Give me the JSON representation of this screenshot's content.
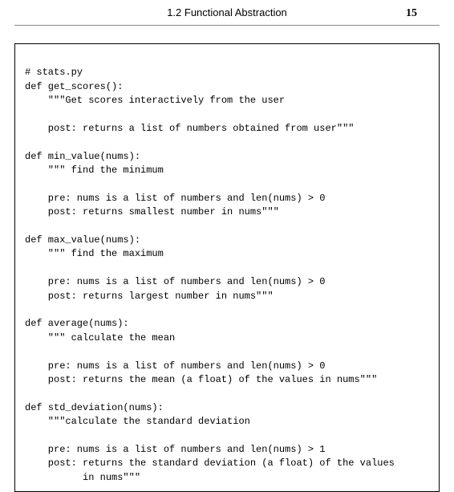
{
  "header": {
    "section_title": "1.2 Functional Abstraction",
    "page_number": "15"
  },
  "code": {
    "lines": [
      "# stats.py",
      "def get_scores():",
      "    \"\"\"Get scores interactively from the user",
      "",
      "    post: returns a list of numbers obtained from user\"\"\"",
      "",
      "def min_value(nums):",
      "    \"\"\" find the minimum",
      "",
      "    pre: nums is a list of numbers and len(nums) > 0",
      "    post: returns smallest number in nums\"\"\"",
      "",
      "def max_value(nums):",
      "    \"\"\" find the maximum",
      "",
      "    pre: nums is a list of numbers and len(nums) > 0",
      "    post: returns largest number in nums\"\"\"",
      "",
      "def average(nums):",
      "    \"\"\" calculate the mean",
      "",
      "    pre: nums is a list of numbers and len(nums) > 0",
      "    post: returns the mean (a float) of the values in nums\"\"\"",
      "",
      "def std_deviation(nums):",
      "    \"\"\"calculate the standard deviation",
      "",
      "    pre: nums is a list of numbers and len(nums) > 1",
      "    post: returns the standard deviation (a float) of the values",
      "          in nums\"\"\""
    ]
  }
}
